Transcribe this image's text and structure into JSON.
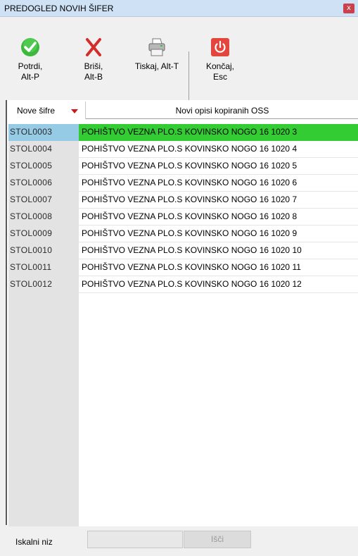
{
  "window": {
    "title": "PREDOGLED NOVIH ŠIFER",
    "close_glyph": "x"
  },
  "toolbar": {
    "confirm": {
      "line1": "Potrdi,",
      "line2": "Alt-P",
      "icon": "check-icon",
      "color": "#2fae2f"
    },
    "delete": {
      "line1": "Briši,",
      "line2": "Alt-B",
      "icon": "x-delete-icon",
      "color": "#cc2a2a"
    },
    "print": {
      "line1": "Tiskaj, Alt-T",
      "icon": "printer-icon"
    },
    "exit": {
      "line1": "Končaj,",
      "line2": "Esc",
      "icon": "power-icon",
      "color": "#d9423a"
    }
  },
  "table": {
    "headers": {
      "code": "Nove šifre",
      "description": "Novi opisi kopiranih OSS"
    },
    "rows": [
      {
        "code": "STOL0003",
        "description": "POHIŠTVO VEZNA PLO.S KOVINSKO NOGO 16 1020 3",
        "selected": true
      },
      {
        "code": "STOL0004",
        "description": "POHIŠTVO VEZNA PLO.S KOVINSKO NOGO 16 1020 4"
      },
      {
        "code": "STOL0005",
        "description": "POHIŠTVO VEZNA PLO.S KOVINSKO NOGO 16 1020 5"
      },
      {
        "code": "STOL0006",
        "description": "POHIŠTVO VEZNA PLO.S KOVINSKO NOGO 16 1020 6"
      },
      {
        "code": "STOL0007",
        "description": "POHIŠTVO VEZNA PLO.S KOVINSKO NOGO 16 1020 7"
      },
      {
        "code": "STOL0008",
        "description": "POHIŠTVO VEZNA PLO.S KOVINSKO NOGO 16 1020 8"
      },
      {
        "code": "STOL0009",
        "description": "POHIŠTVO VEZNA PLO.S KOVINSKO NOGO 16 1020 9"
      },
      {
        "code": "STOL0010",
        "description": "POHIŠTVO VEZNA PLO.S KOVINSKO NOGO 16 1020 10"
      },
      {
        "code": "STOL0011",
        "description": "POHIŠTVO VEZNA PLO.S KOVINSKO NOGO 16 1020 11"
      },
      {
        "code": "STOL0012",
        "description": "POHIŠTVO VEZNA PLO.S KOVINSKO NOGO 16 1020 12"
      }
    ]
  },
  "search": {
    "label": "Iskalni niz",
    "value": "",
    "button": "Išči"
  }
}
